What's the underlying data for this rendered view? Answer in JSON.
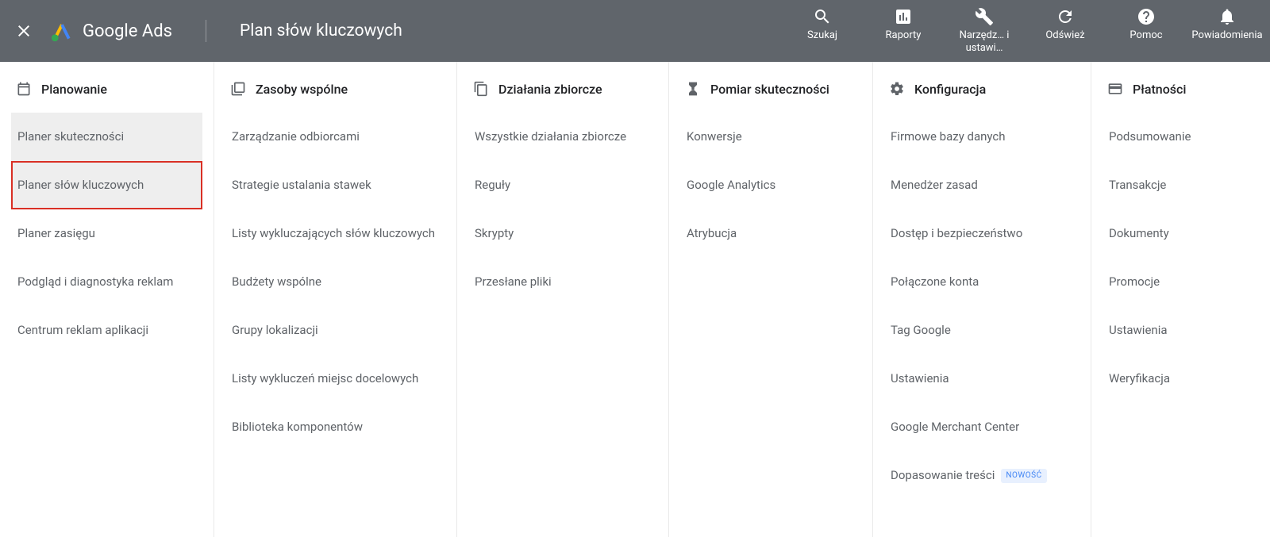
{
  "header": {
    "app_name": "Google Ads",
    "page_title": "Plan słów kluczowych",
    "nav": [
      {
        "key": "search",
        "label": "Szukaj"
      },
      {
        "key": "reports",
        "label": "Raporty"
      },
      {
        "key": "tools",
        "label": "Narzędz… i ustawi…"
      },
      {
        "key": "refresh",
        "label": "Odśwież"
      },
      {
        "key": "help",
        "label": "Pomoc"
      },
      {
        "key": "notifs",
        "label": "Powiadomienia"
      }
    ]
  },
  "columns": [
    {
      "key": "planning",
      "title": "Planowanie",
      "items": [
        {
          "label": "Planer skuteczności",
          "state": "hovered"
        },
        {
          "label": "Planer słów kluczowych",
          "state": "highlighted"
        },
        {
          "label": "Planer zasięgu"
        },
        {
          "label": "Podgląd i diagnostyka reklam"
        },
        {
          "label": "Centrum reklam aplikacji"
        }
      ]
    },
    {
      "key": "shared",
      "title": "Zasoby wspólne",
      "items": [
        {
          "label": "Zarządzanie odbiorcami"
        },
        {
          "label": "Strategie ustalania stawek"
        },
        {
          "label": "Listy wykluczających słów kluczowych"
        },
        {
          "label": "Budżety wspólne"
        },
        {
          "label": "Grupy lokalizacji"
        },
        {
          "label": "Listy wykluczeń miejsc docelowych"
        },
        {
          "label": "Biblioteka komponentów"
        }
      ]
    },
    {
      "key": "bulk",
      "title": "Działania zbiorcze",
      "items": [
        {
          "label": "Wszystkie działania zbiorcze"
        },
        {
          "label": "Reguły"
        },
        {
          "label": "Skrypty"
        },
        {
          "label": "Przesłane pliki"
        }
      ]
    },
    {
      "key": "measure",
      "title": "Pomiar skuteczności",
      "items": [
        {
          "label": "Konwersje"
        },
        {
          "label": "Google Analytics"
        },
        {
          "label": "Atrybucja"
        }
      ]
    },
    {
      "key": "config",
      "title": "Konfiguracja",
      "items": [
        {
          "label": "Firmowe bazy danych"
        },
        {
          "label": "Menedżer zasad"
        },
        {
          "label": "Dostęp i bezpieczeństwo"
        },
        {
          "label": "Połączone konta"
        },
        {
          "label": "Tag Google"
        },
        {
          "label": "Ustawienia"
        },
        {
          "label": "Google Merchant Center"
        },
        {
          "label": "Dopasowanie treści",
          "badge": "NOWOŚĆ"
        }
      ]
    },
    {
      "key": "billing",
      "title": "Płatności",
      "items": [
        {
          "label": "Podsumowanie"
        },
        {
          "label": "Transakcje"
        },
        {
          "label": "Dokumenty"
        },
        {
          "label": "Promocje"
        },
        {
          "label": "Ustawienia"
        },
        {
          "label": "Weryfikacja"
        }
      ]
    }
  ]
}
